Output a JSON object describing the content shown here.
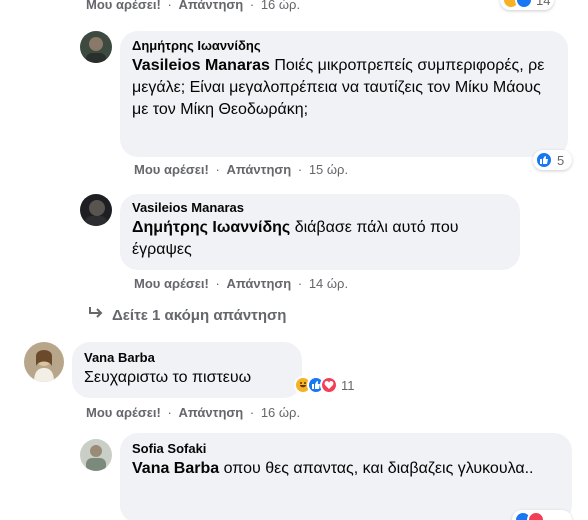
{
  "colors": {
    "like_blue": "#1877f2",
    "haha_yellow": "#f7b125",
    "love_red": "#f33e58",
    "bubble_bg": "#f0f2f5"
  },
  "labels": {
    "like": "Μου αρέσει!",
    "reply": "Απάντηση",
    "separator": "·"
  },
  "top_row": {
    "time": "16 ώρ.",
    "reaction_count": "14"
  },
  "reply1": {
    "author": "Δημήτρης Ιωαννίδης",
    "mention": "Vasileios Manaras",
    "text": "Ποιές μικροπρεπείς συμπεριφορές, ρε μεγάλε; Είναι μεγαλοπρέπεια να ταυτίζεις τον Μίκυ Μάους με τον Μίκη Θεοδωράκη;",
    "time": "15 ώρ.",
    "reaction_count": "5",
    "reaction_icons": [
      "like-icon"
    ]
  },
  "reply2": {
    "author": "Vasileios Manaras",
    "mention": "Δημήτρης Ιωαννίδης",
    "text": "διάβασε πάλι αυτό που έγραψες",
    "time": "14 ώρ."
  },
  "more_replies": {
    "label": "Δείτε 1 ακόμη απάντηση"
  },
  "comment2": {
    "author": "Vana Barba",
    "text": "Σευχαριστω το πιστευω",
    "time": "16 ώρ.",
    "reaction_count": "11",
    "reaction_icons": [
      "haha-icon",
      "like-icon",
      "love-icon"
    ]
  },
  "reply3": {
    "author": "Sofia Sofaki",
    "mention": "Vana Barba",
    "text": "οπου θες απαντας, και διαβαζεις γλυκουλα.."
  }
}
